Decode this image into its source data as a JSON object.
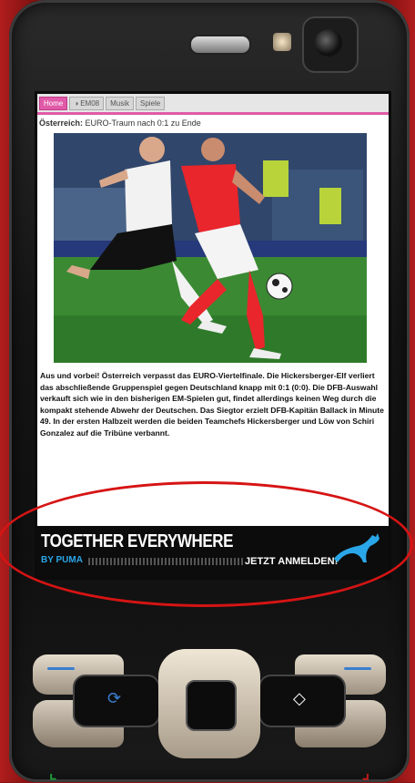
{
  "browser": {
    "tabs": [
      {
        "label": "Home",
        "active": true
      },
      {
        "label": "EM08",
        "icon": "globe-icon",
        "active": false
      },
      {
        "label": "Musik",
        "active": false
      },
      {
        "label": "Spiele",
        "active": false
      }
    ]
  },
  "article": {
    "headline_prefix": "Österreich:",
    "headline": " EURO-Traum nach 0:1 zu Ende",
    "body": "Aus und vorbei! Österreich verpasst das EURO-Viertelfinale. Die Hickersberger-Elf verliert das abschließende Gruppenspiel gegen Deutschland knapp mit 0:1 (0:0). Die DFB-Auswahl verkauft sich wie in den bisherigen EM-Spielen gut, findet allerdings keinen Weg durch die kompakt stehende Abwehr der Deutschen. Das Siegtor erzielt DFB-Kapitän Ballack in Minute 49. In der ersten Halbzeit werden die beiden Teamchefs Hickersberger und Löw von Schiri Gonzalez auf die Tribüne verbannt."
  },
  "ad": {
    "title": "TOGETHER EVERYWHERE",
    "subtitle": "BY PUMA",
    "cta": "JETZT ANMELDEN!",
    "accent_color": "#2aa7e8"
  },
  "colors": {
    "tab_active": "#e05aa8",
    "highlight_ellipse": "#d61414",
    "call_green": "#1d9a3a",
    "end_red": "#c21b1b"
  }
}
